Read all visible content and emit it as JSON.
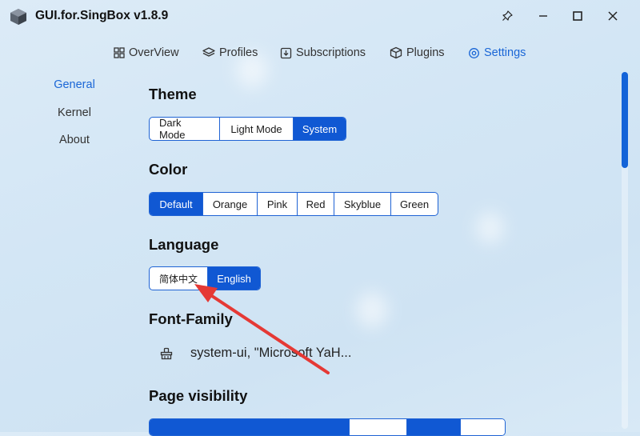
{
  "window": {
    "title": "GUI.for.SingBox v1.8.9"
  },
  "nav": [
    {
      "label": "OverView",
      "icon": "overview-icon",
      "active": false
    },
    {
      "label": "Profiles",
      "icon": "profiles-icon",
      "active": false
    },
    {
      "label": "Subscriptions",
      "icon": "subscriptions-icon",
      "active": false
    },
    {
      "label": "Plugins",
      "icon": "plugins-icon",
      "active": false
    },
    {
      "label": "Settings",
      "icon": "settings-icon",
      "active": true
    }
  ],
  "sidebar": [
    {
      "label": "General",
      "active": true
    },
    {
      "label": "Kernel",
      "active": false
    },
    {
      "label": "About",
      "active": false
    }
  ],
  "sections": {
    "theme": {
      "title": "Theme",
      "options": [
        "Dark Mode",
        "Light Mode",
        "System"
      ],
      "selected": "System"
    },
    "color": {
      "title": "Color",
      "options": [
        "Default",
        "Orange",
        "Pink",
        "Red",
        "Skyblue",
        "Green"
      ],
      "selected": "Default"
    },
    "language": {
      "title": "Language",
      "options": [
        "简体中文",
        "English"
      ],
      "selected": "English"
    },
    "font": {
      "title": "Font-Family",
      "value": "system-ui, \"Microsoft YaH..."
    },
    "visibility": {
      "title": "Page visibility"
    }
  },
  "colors": {
    "accent": "#1058d3",
    "annotation_arrow": "#e53935"
  }
}
